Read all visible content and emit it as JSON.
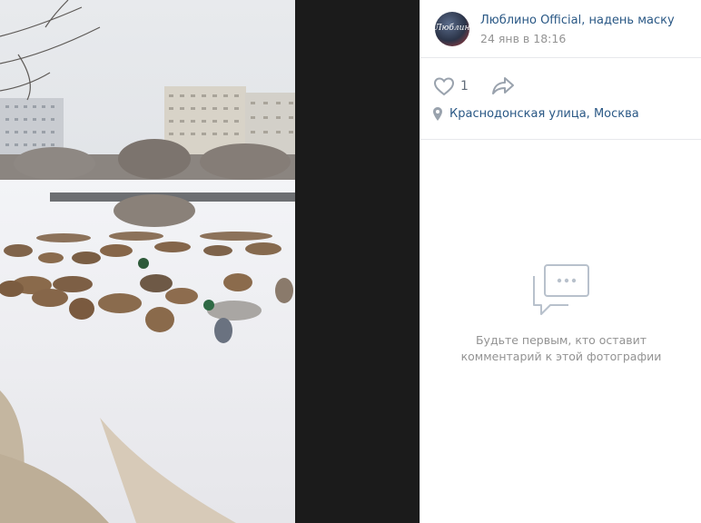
{
  "post": {
    "author": "Люблино Official, надень маску",
    "avatar_text": "Люблино",
    "time": "24 янв в 18:16"
  },
  "actions": {
    "like_icon": "heart-icon",
    "like_count": "1",
    "share_icon": "share-arrow-icon"
  },
  "location": {
    "icon": "map-pin-icon",
    "text": "Краснодонская улица, Москва"
  },
  "comments": {
    "empty_icon": "comment-bubble-icon",
    "empty_line1": "Будьте первым, кто оставит",
    "empty_line2": "комментарий к этой фотографии"
  },
  "colors": {
    "link": "#2a5885",
    "muted": "#939393",
    "icon": "#99a2ad"
  }
}
